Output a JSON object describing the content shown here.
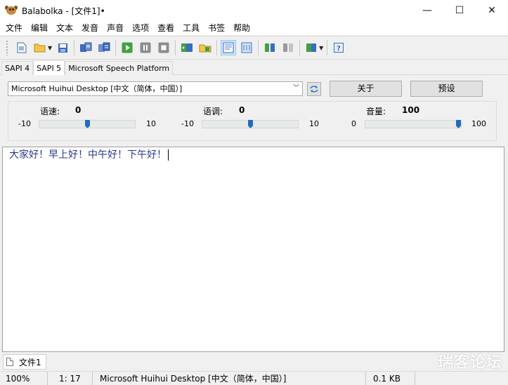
{
  "window": {
    "title": "Balabolka - [文件1]•",
    "minimize": "—",
    "maximize": "☐",
    "close": "✕"
  },
  "menu": [
    "文件",
    "编辑",
    "文本",
    "发音",
    "声音",
    "选项",
    "查看",
    "工具",
    "书签",
    "帮助"
  ],
  "tabs": {
    "sapi4": "SAPI 4",
    "sapi5": "SAPI 5",
    "msp": "Microsoft Speech Platform",
    "active": "SAPI 5"
  },
  "voice": {
    "selected": "Microsoft Huihui Desktop [中文（简体，中国）]",
    "about_label": "关于",
    "preset_label": "预设"
  },
  "sliders": {
    "rate": {
      "label": "语速:",
      "value": "0",
      "min": "-10",
      "max": "10",
      "fraction": 0.5
    },
    "pitch": {
      "label": "语调:",
      "value": "0",
      "min": "-10",
      "max": "10",
      "fraction": 0.5
    },
    "volume": {
      "label": "音量:",
      "value": "100",
      "min": "0",
      "max": "100",
      "fraction": 1.0
    }
  },
  "editor": {
    "text": "大家好！早上好！中午好！下午好！"
  },
  "doc_tab": {
    "label": "文件1"
  },
  "status": {
    "zoom": "100%",
    "position": "1:  17",
    "voice": "Microsoft Huihui Desktop [中文（简体，中国）]",
    "size": "0.1 KB"
  },
  "watermark": "瑞客论坛",
  "colors": {
    "accent": "#1f6bc5",
    "editor_text": "#2b3a8c",
    "toolbar_active": "#cce4f7"
  }
}
